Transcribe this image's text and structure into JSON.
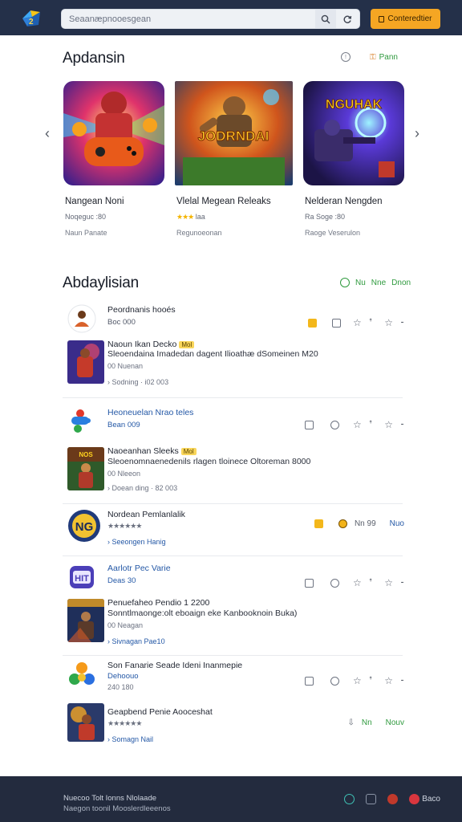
{
  "header": {
    "search_placeholder": "Seaanæpnooesgean",
    "cta_label": "Conteredtier",
    "logo_icon": "app-logo-icon",
    "colors": {
      "bar": "#243049",
      "cta": "#f5a623"
    }
  },
  "featured": {
    "title": "Apdansin",
    "action_label": "Pann",
    "cards": [
      {
        "title": "Nangean Noni",
        "meta": "Noqeguc :80",
        "foot": "Naun Panate"
      },
      {
        "title": "Vlelal Megean Releaks",
        "meta_stars": "★★★",
        "meta": "laa",
        "foot": "Regunoeonan",
        "art_text": "JODRNDAI"
      },
      {
        "title": "Nelderan Nengden",
        "meta": "Ra Soge :80",
        "foot": "Raoge Veserulon",
        "art_text": "NGUHAK"
      }
    ]
  },
  "list_section": {
    "title": "Abdaylisian",
    "actions": {
      "a1": "Nu",
      "a2": "Nne",
      "a3": "Dnon"
    },
    "items": [
      {
        "t1": "Peordnanis hooés",
        "t2": "Boc 000"
      },
      {
        "t1": "Naoun Ikan Decko",
        "badge": "Mol",
        "t2": "Sleoendaina Imadedan dagent Ilioathæ dSomeinen M20",
        "t3": "00 Nuenan",
        "t4": "Sodning · i02 003"
      },
      {
        "t1": "Heoneuelan Nrao teles",
        "t2": "Bean 009"
      },
      {
        "t1": "Naoeanhan Sleeks",
        "badge": "Mol",
        "t2": "Sleoenomnaenedenils rlagen tloinece Oltoreman 8000",
        "t3": "00 Nleeon",
        "t4": "Doean ding · 82 003"
      },
      {
        "t1": "Nordean Pemlanlalik",
        "stars": "★★★★★★",
        "t3": "Seeongen Hanig",
        "act": "Nn 99",
        "act2": "Nuo"
      },
      {
        "t1": "Aarlotr Pec Varie",
        "t2": "Deas 30",
        "art": "HIT"
      },
      {
        "t1": "Penuefaheo Pendio",
        "t1b": "1 2200",
        "t2": "Sonntlmaonge:olt eboaign eke Kanbooknoin Buka)",
        "t3": "00 Neagan",
        "t4": "Sivnagan Pae10"
      },
      {
        "t1": "Son Fanarie Seade Ideni Inanmepie",
        "t2": "Dehoouo",
        "t3": "240 180"
      },
      {
        "t1": "Geapbend Penie Aooceshat",
        "stars": "★★★★★★",
        "t3": "Somagn Nail",
        "act": "Nn",
        "act2": "Nouv"
      }
    ],
    "badge_color": "#f9d65b"
  },
  "footer": {
    "line1": "Nuecoo Tolt Ionns Nlolaade",
    "line2": "Naegon toonil Mooslerdleeenos",
    "label": "Baco"
  }
}
